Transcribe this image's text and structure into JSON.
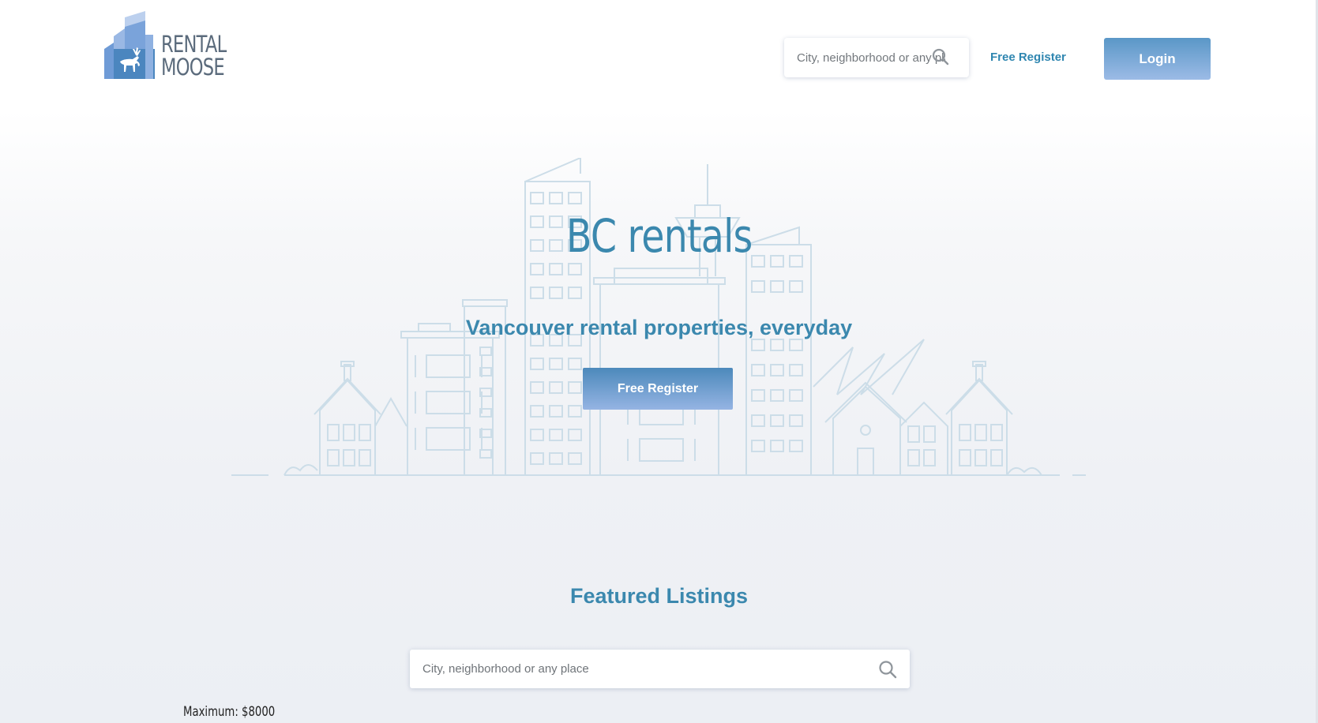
{
  "app": {
    "brand_line1": "RENTAL",
    "brand_line2": "MOOSE"
  },
  "header": {
    "search_placeholder": "City, neighborhood or any place",
    "register_label": "Free Register",
    "login_label": "Login"
  },
  "hero": {
    "title": "BC rentals",
    "subtitle": "Vancouver rental properties, everyday",
    "cta_label": "Free Register"
  },
  "featured": {
    "title": "Featured Listings",
    "search_placeholder": "City, neighborhood or any place",
    "max_label": "Maximum: $8000"
  },
  "colors": {
    "accent": "#3b88ae",
    "button_top": "#4c89bb",
    "button_bottom": "#95b4e3",
    "skyline": "#c9dbe7"
  },
  "icons": {
    "search": "search-icon",
    "logo": "moose-logo-icon",
    "skyline": "city-skyline-illustration"
  }
}
